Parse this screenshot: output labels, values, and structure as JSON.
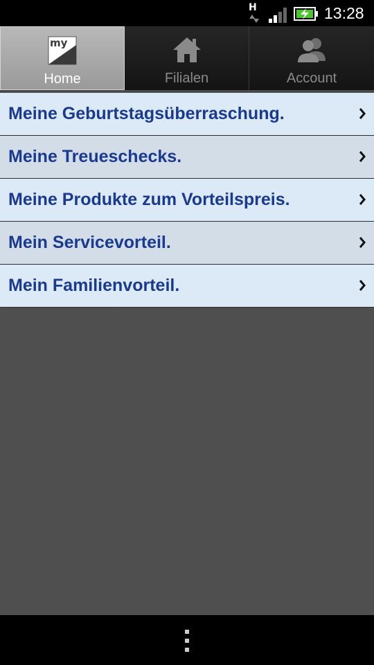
{
  "status_bar": {
    "network_type": "H",
    "time": "13:28"
  },
  "tabs": [
    {
      "label": "Home",
      "icon": "my-logo-icon",
      "active": true
    },
    {
      "label": "Filialen",
      "icon": "home-icon",
      "active": false
    },
    {
      "label": "Account",
      "icon": "people-icon",
      "active": false
    }
  ],
  "menu": {
    "items": [
      {
        "label": "Meine Geburtstagsüberraschung."
      },
      {
        "label": "Meine Treueschecks."
      },
      {
        "label": "Meine Produkte zum Vorteilspreis."
      },
      {
        "label": "Mein Servicevorteil."
      },
      {
        "label": "Mein Familienvorteil."
      }
    ]
  },
  "colors": {
    "item_text": "#1a3a8f",
    "item_bg_odd": "#dce9f7",
    "item_bg_even": "#d3dde8",
    "content_bg": "#4f4f4f"
  }
}
